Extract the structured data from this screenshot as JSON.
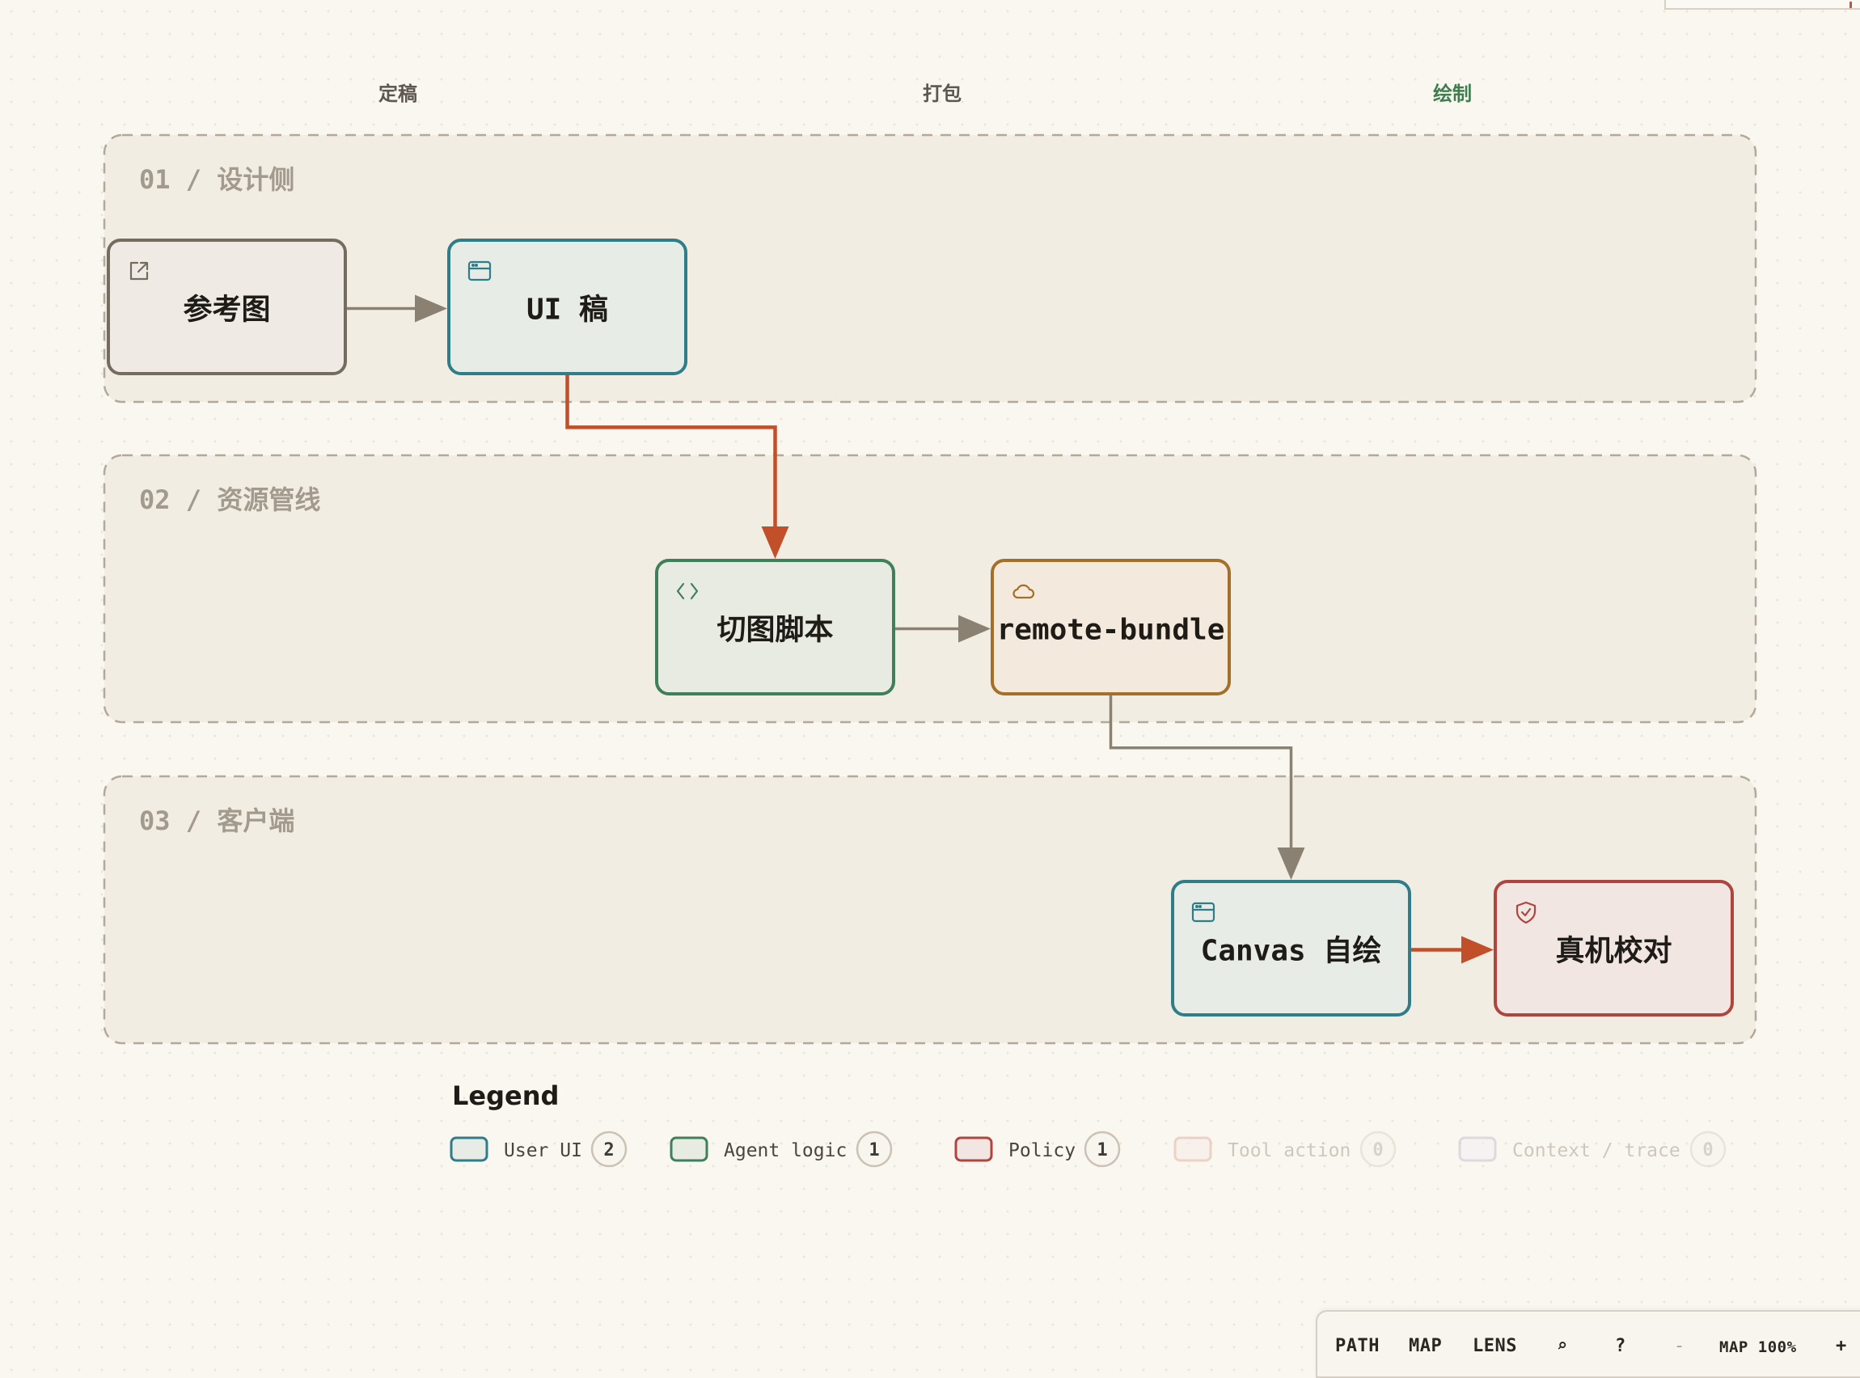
{
  "columns": [
    {
      "label": "定稿",
      "color": "#5e5750"
    },
    {
      "label": "打包",
      "color": "#5e5750"
    },
    {
      "label": "绘制",
      "color": "#3f7d4f"
    }
  ],
  "lanes": [
    {
      "label": "01 / 设计侧"
    },
    {
      "label": "02 / 资源管线"
    },
    {
      "label": "03 / 客户端"
    }
  ],
  "nodes": [
    {
      "id": "ref",
      "label": "参考图",
      "icon": "external-link-icon",
      "stroke": "#756c60",
      "fill": "#efebe4"
    },
    {
      "id": "ui",
      "label": "UI 稿",
      "icon": "window-icon",
      "stroke": "#2f7d88",
      "fill": "#e7ece6"
    },
    {
      "id": "script",
      "label": "切图脚本",
      "icon": "code-icon",
      "stroke": "#3f7f5a",
      "fill": "#e7ebe1"
    },
    {
      "id": "bundle",
      "label": "remote-bundle",
      "icon": "cloud-icon",
      "stroke": "#a46e2b",
      "fill": "#f3eadd"
    },
    {
      "id": "canvas",
      "label": "Canvas 自绘",
      "icon": "window-icon",
      "stroke": "#2f7d88",
      "fill": "#e7ece6"
    },
    {
      "id": "verify",
      "label": "真机校对",
      "icon": "shield-icon",
      "stroke": "#b0443f",
      "fill": "#f2e6e2"
    }
  ],
  "edges": [
    {
      "from": "ref",
      "to": "ui",
      "color": "#8a8172"
    },
    {
      "from": "ui",
      "to": "script",
      "color": "#c04f2a"
    },
    {
      "from": "script",
      "to": "bundle",
      "color": "#8a8172"
    },
    {
      "from": "bundle",
      "to": "canvas",
      "color": "#8a8172"
    },
    {
      "from": "canvas",
      "to": "verify",
      "color": "#c04f2a"
    }
  ],
  "legend": {
    "title": "Legend",
    "items": [
      {
        "label": "User UI",
        "count": "2",
        "stroke": "#2f7d88",
        "fill": "#e7ece6",
        "dim": false
      },
      {
        "label": "Agent logic",
        "count": "1",
        "stroke": "#3f7f5a",
        "fill": "#e7ebe1",
        "dim": false
      },
      {
        "label": "Policy",
        "count": "1",
        "stroke": "#b0443f",
        "fill": "#f2e6e2",
        "dim": false
      },
      {
        "label": "Tool action",
        "count": "0",
        "stroke": "#e2b5a4",
        "fill": "#f7ece6",
        "dim": true
      },
      {
        "label": "Context / trace",
        "count": "0",
        "stroke": "#cbbfd2",
        "fill": "#f3eff3",
        "dim": true
      }
    ]
  },
  "toolbar": {
    "path": "PATH",
    "map": "MAP",
    "lens": "LENS",
    "search_icon": "⌕",
    "help": "?",
    "zoom_out": "-",
    "zoom_label": "MAP 100%",
    "zoom_in": "+"
  }
}
